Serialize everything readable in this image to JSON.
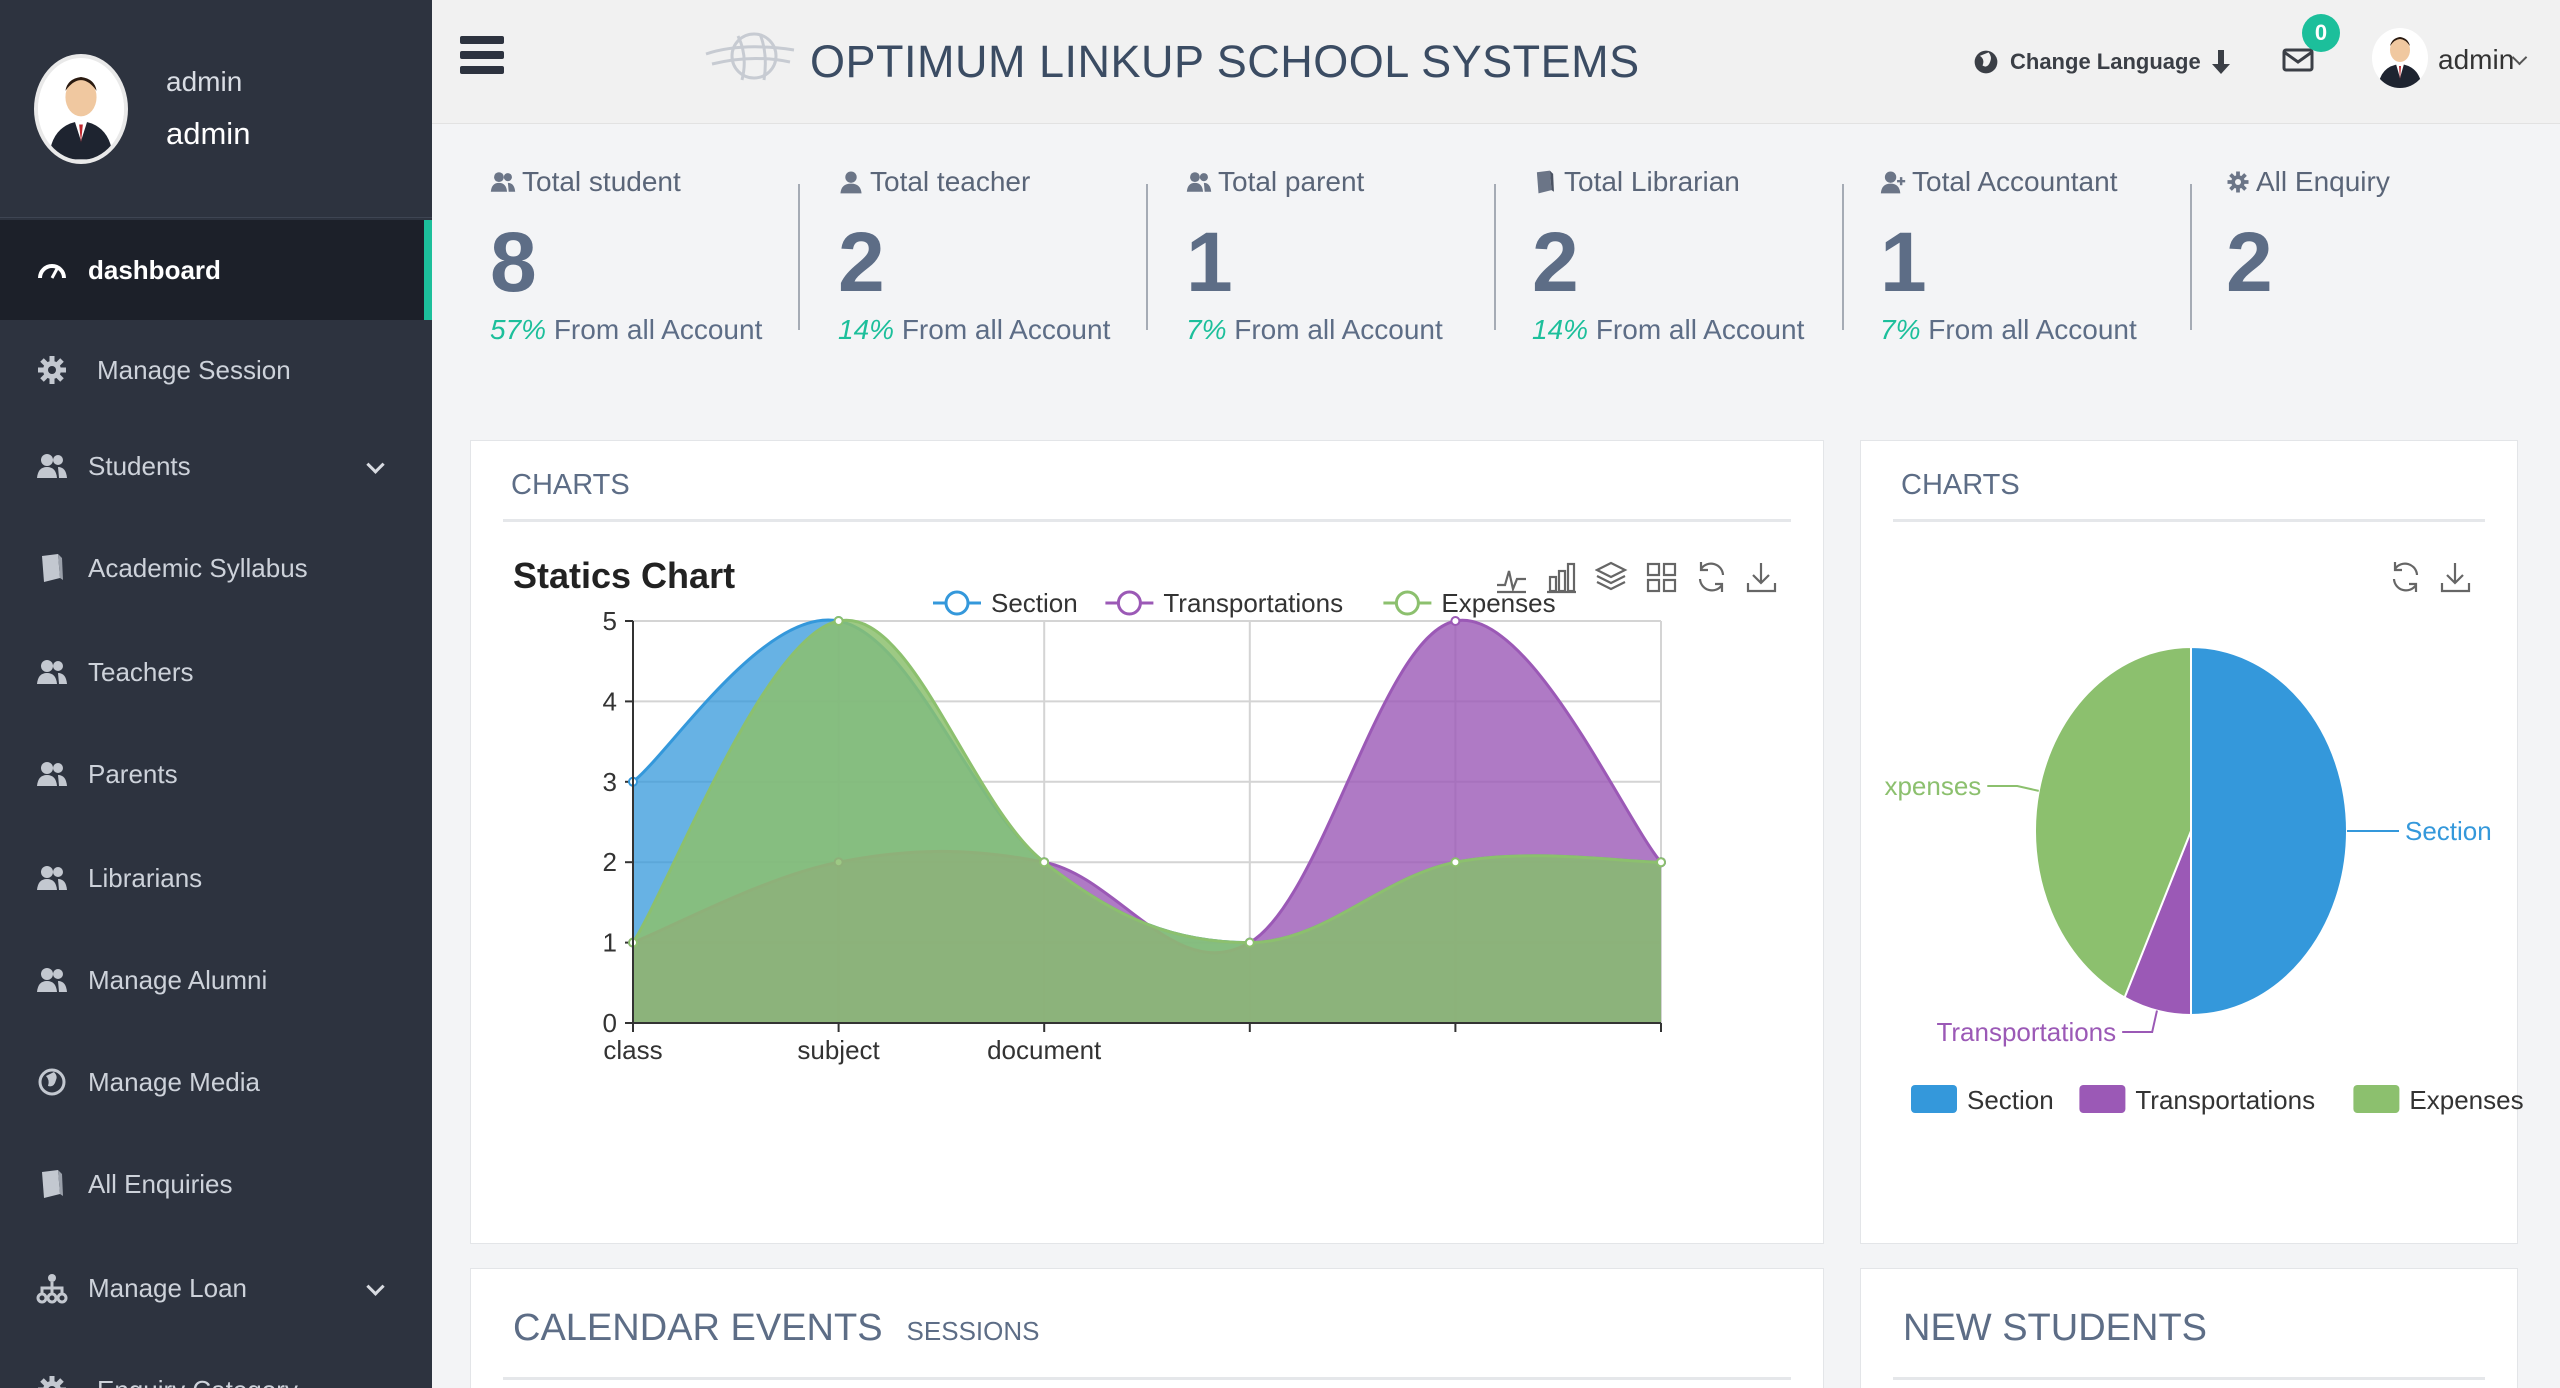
{
  "sidebar": {
    "user_name": "admin",
    "user_role": "admin",
    "items": [
      {
        "label": "dashboard",
        "icon": "speedometer-icon",
        "active": true
      },
      {
        "label": "Manage Session",
        "icon": "gear-icon"
      },
      {
        "label": "Students",
        "icon": "users-icon",
        "expandable": true
      },
      {
        "label": "Academic Syllabus",
        "icon": "book-icon"
      },
      {
        "label": "Teachers",
        "icon": "users-icon"
      },
      {
        "label": "Parents",
        "icon": "users-icon"
      },
      {
        "label": "Librarians",
        "icon": "users-icon"
      },
      {
        "label": "Manage Alumni",
        "icon": "users-icon"
      },
      {
        "label": "Manage Media",
        "icon": "globe-icon"
      },
      {
        "label": "All Enquiries",
        "icon": "book-icon"
      },
      {
        "label": "Manage Loan",
        "icon": "sitemap-icon",
        "expandable": true
      },
      {
        "label": "Enquiry Category",
        "icon": "gear-icon"
      }
    ]
  },
  "header": {
    "title": "OPTIMUM LINKUP SCHOOL SYSTEMS",
    "language_label": "Change Language",
    "mail_count": "0",
    "user_label": "admin"
  },
  "stats": [
    {
      "label": "Total student",
      "value": "8",
      "percent": "57%",
      "suffix": " From all Account",
      "icon": "users-icon"
    },
    {
      "label": "Total teacher",
      "value": "2",
      "percent": "14%",
      "suffix": " From all Account",
      "icon": "user-icon"
    },
    {
      "label": "Total parent",
      "value": "1",
      "percent": "7%",
      "suffix": " From all Account",
      "icon": "users-icon"
    },
    {
      "label": "Total Librarian",
      "value": "2",
      "percent": "14%",
      "suffix": " From all Account",
      "icon": "book-icon"
    },
    {
      "label": "Total Accountant",
      "value": "1",
      "percent": "7%",
      "suffix": " From all Account",
      "icon": "user-plus-icon"
    },
    {
      "label": "All Enquiry",
      "value": "2",
      "icon": "gear-icon"
    }
  ],
  "charts_panel": {
    "heading": "CHARTS",
    "chart_title": "Statics Chart"
  },
  "pie_panel": {
    "heading": "CHARTS"
  },
  "calendar_panel": {
    "heading": "CALENDAR EVENTS",
    "sub": "SESSIONS"
  },
  "students_panel": {
    "heading": "NEW STUDENTS"
  },
  "colors": {
    "section": "#3498db",
    "transportations": "#9b59b6",
    "expenses": "#8cc06e",
    "accent": "#1cbf9b",
    "sidebar": "#2d333f"
  },
  "chart_data": [
    {
      "type": "area",
      "title": "Statics Chart",
      "categories": [
        "class",
        "subject",
        "document",
        "",
        "",
        ""
      ],
      "ylim": [
        0,
        5
      ],
      "yticks": [
        0,
        1,
        2,
        3,
        4,
        5
      ],
      "grid": true,
      "legend_position": "top",
      "series": [
        {
          "name": "Section",
          "values": [
            3,
            5,
            2,
            1,
            2,
            2
          ]
        },
        {
          "name": "Transportations",
          "values": [
            1,
            2,
            2,
            1,
            5,
            2
          ]
        },
        {
          "name": "Expenses",
          "values": [
            1,
            5,
            2,
            1,
            2,
            2
          ]
        }
      ]
    },
    {
      "type": "pie",
      "legend_position": "bottom",
      "slices": [
        {
          "name": "Section",
          "value": 50,
          "label": "Section"
        },
        {
          "name": "Transportations",
          "value": 7,
          "label": "Transportations"
        },
        {
          "name": "Expenses",
          "value": 43,
          "label": "xpenses"
        }
      ]
    }
  ]
}
